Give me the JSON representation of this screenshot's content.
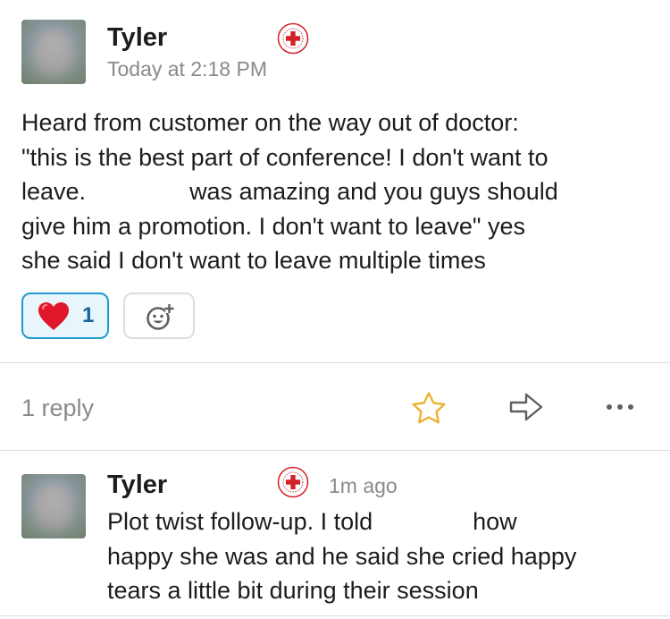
{
  "message": {
    "author": "Tyler",
    "timestamp": "Today at 2:18 PM",
    "badge_icon": "red-cross-badge-icon",
    "lines": [
      "Heard from customer on the way out of doctor:",
      "\"this is the best part of conference! I don't want to",
      [
        "leave.",
        "was amazing and you guys should"
      ],
      "give him a promotion. I don't want to leave\" yes",
      "she said I don't want to leave multiple times"
    ],
    "reactions": [
      {
        "emoji": "heart",
        "count": "1",
        "active_color": "#1d9bd1"
      }
    ],
    "add_reaction_icon": "add-reaction-icon"
  },
  "thread_bar": {
    "reply_count": "1 reply",
    "actions": [
      "star-icon",
      "share-arrow-icon",
      "more-icon"
    ],
    "star_color": "#ecb22e"
  },
  "reply": {
    "author": "Tyler",
    "timestamp": "1m ago",
    "badge_icon": "red-cross-badge-icon",
    "lines": [
      [
        "Plot twist follow-up. I told",
        "how"
      ],
      "happy she was and he said she cried happy",
      "tears a little bit during their session"
    ]
  }
}
